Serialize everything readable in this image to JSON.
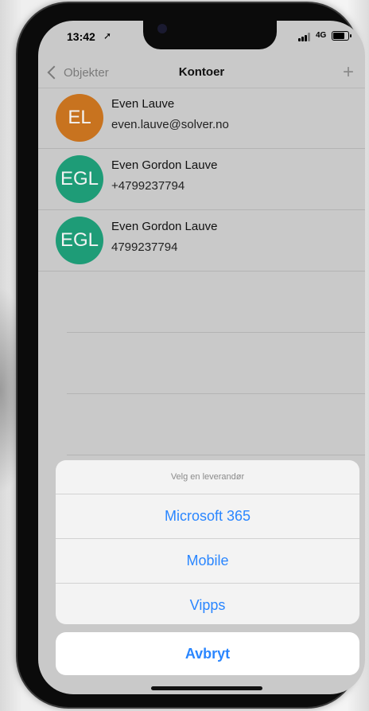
{
  "status_bar": {
    "time": "13:42",
    "network": "4G"
  },
  "nav": {
    "back_label": "Objekter",
    "title": "Kontoer",
    "add_label": "+"
  },
  "contacts": [
    {
      "initials": "EL",
      "name": "Even Lauve",
      "detail": "even.lauve@solver.no",
      "color": "#c8731f"
    },
    {
      "initials": "EGL",
      "name": "Even Gordon Lauve",
      "detail": "+4799237794",
      "color": "#1e9c77"
    },
    {
      "initials": "EGL",
      "name": "Even Gordon Lauve",
      "detail": "4799237794",
      "color": "#1e9c77"
    }
  ],
  "action_sheet": {
    "title": "Velg en leverandør",
    "options": [
      "Microsoft 365",
      "Mobile",
      "Vipps"
    ],
    "cancel_label": "Avbryt"
  },
  "colors": {
    "accent": "#2a86ff",
    "dim_background": "#c9c9c9"
  }
}
